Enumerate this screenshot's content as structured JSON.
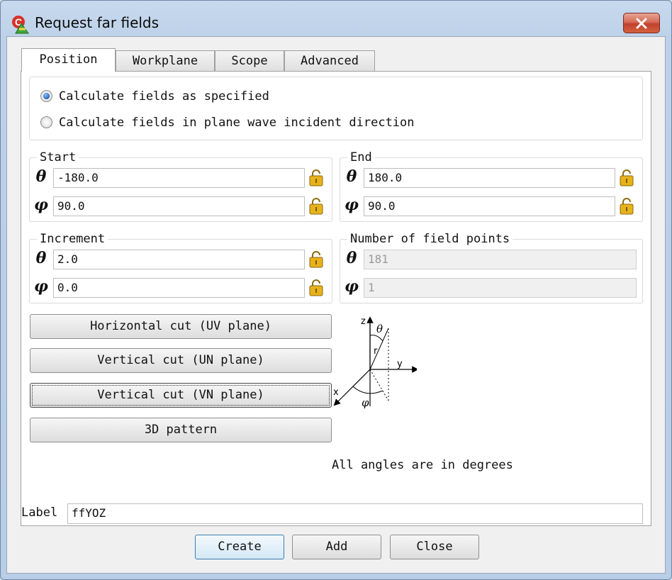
{
  "window": {
    "title": "Request far fields"
  },
  "tabs": [
    {
      "label": "Position",
      "active": true
    },
    {
      "label": "Workplane",
      "active": false
    },
    {
      "label": "Scope",
      "active": false
    },
    {
      "label": "Advanced",
      "active": false
    }
  ],
  "calc_mode": {
    "options": [
      {
        "label": "Calculate fields as specified",
        "checked": true
      },
      {
        "label": "Calculate fields in plane wave incident direction",
        "checked": false
      }
    ]
  },
  "start": {
    "title": "Start",
    "theta": "-180.0",
    "phi": "90.0"
  },
  "end": {
    "title": "End",
    "theta": "180.0",
    "phi": "90.0"
  },
  "increment": {
    "title": "Increment",
    "theta": "2.0",
    "phi": "0.0"
  },
  "num_points": {
    "title": "Number of field points",
    "theta": "181",
    "phi": "1"
  },
  "symbols": {
    "theta": "θ",
    "phi": "φ"
  },
  "cut_buttons": {
    "horizontal": "Horizontal cut (UV plane)",
    "vertical_un": "Vertical cut (UN plane)",
    "vertical_vn": "Vertical cut (VN plane)",
    "pattern_3d": "3D pattern"
  },
  "diagram": {
    "z": "z",
    "y": "y",
    "x": "x",
    "r": "r",
    "theta": "θ",
    "phi": "φ"
  },
  "note": "All angles are in degrees",
  "label": {
    "caption": "Label",
    "value": "ffYOZ"
  },
  "footer": {
    "create": "Create",
    "add": "Add",
    "close": "Close"
  },
  "colors": {
    "lock": "#e8b21a",
    "close_button": "#c7432c",
    "accent": "#1d5fb4"
  }
}
